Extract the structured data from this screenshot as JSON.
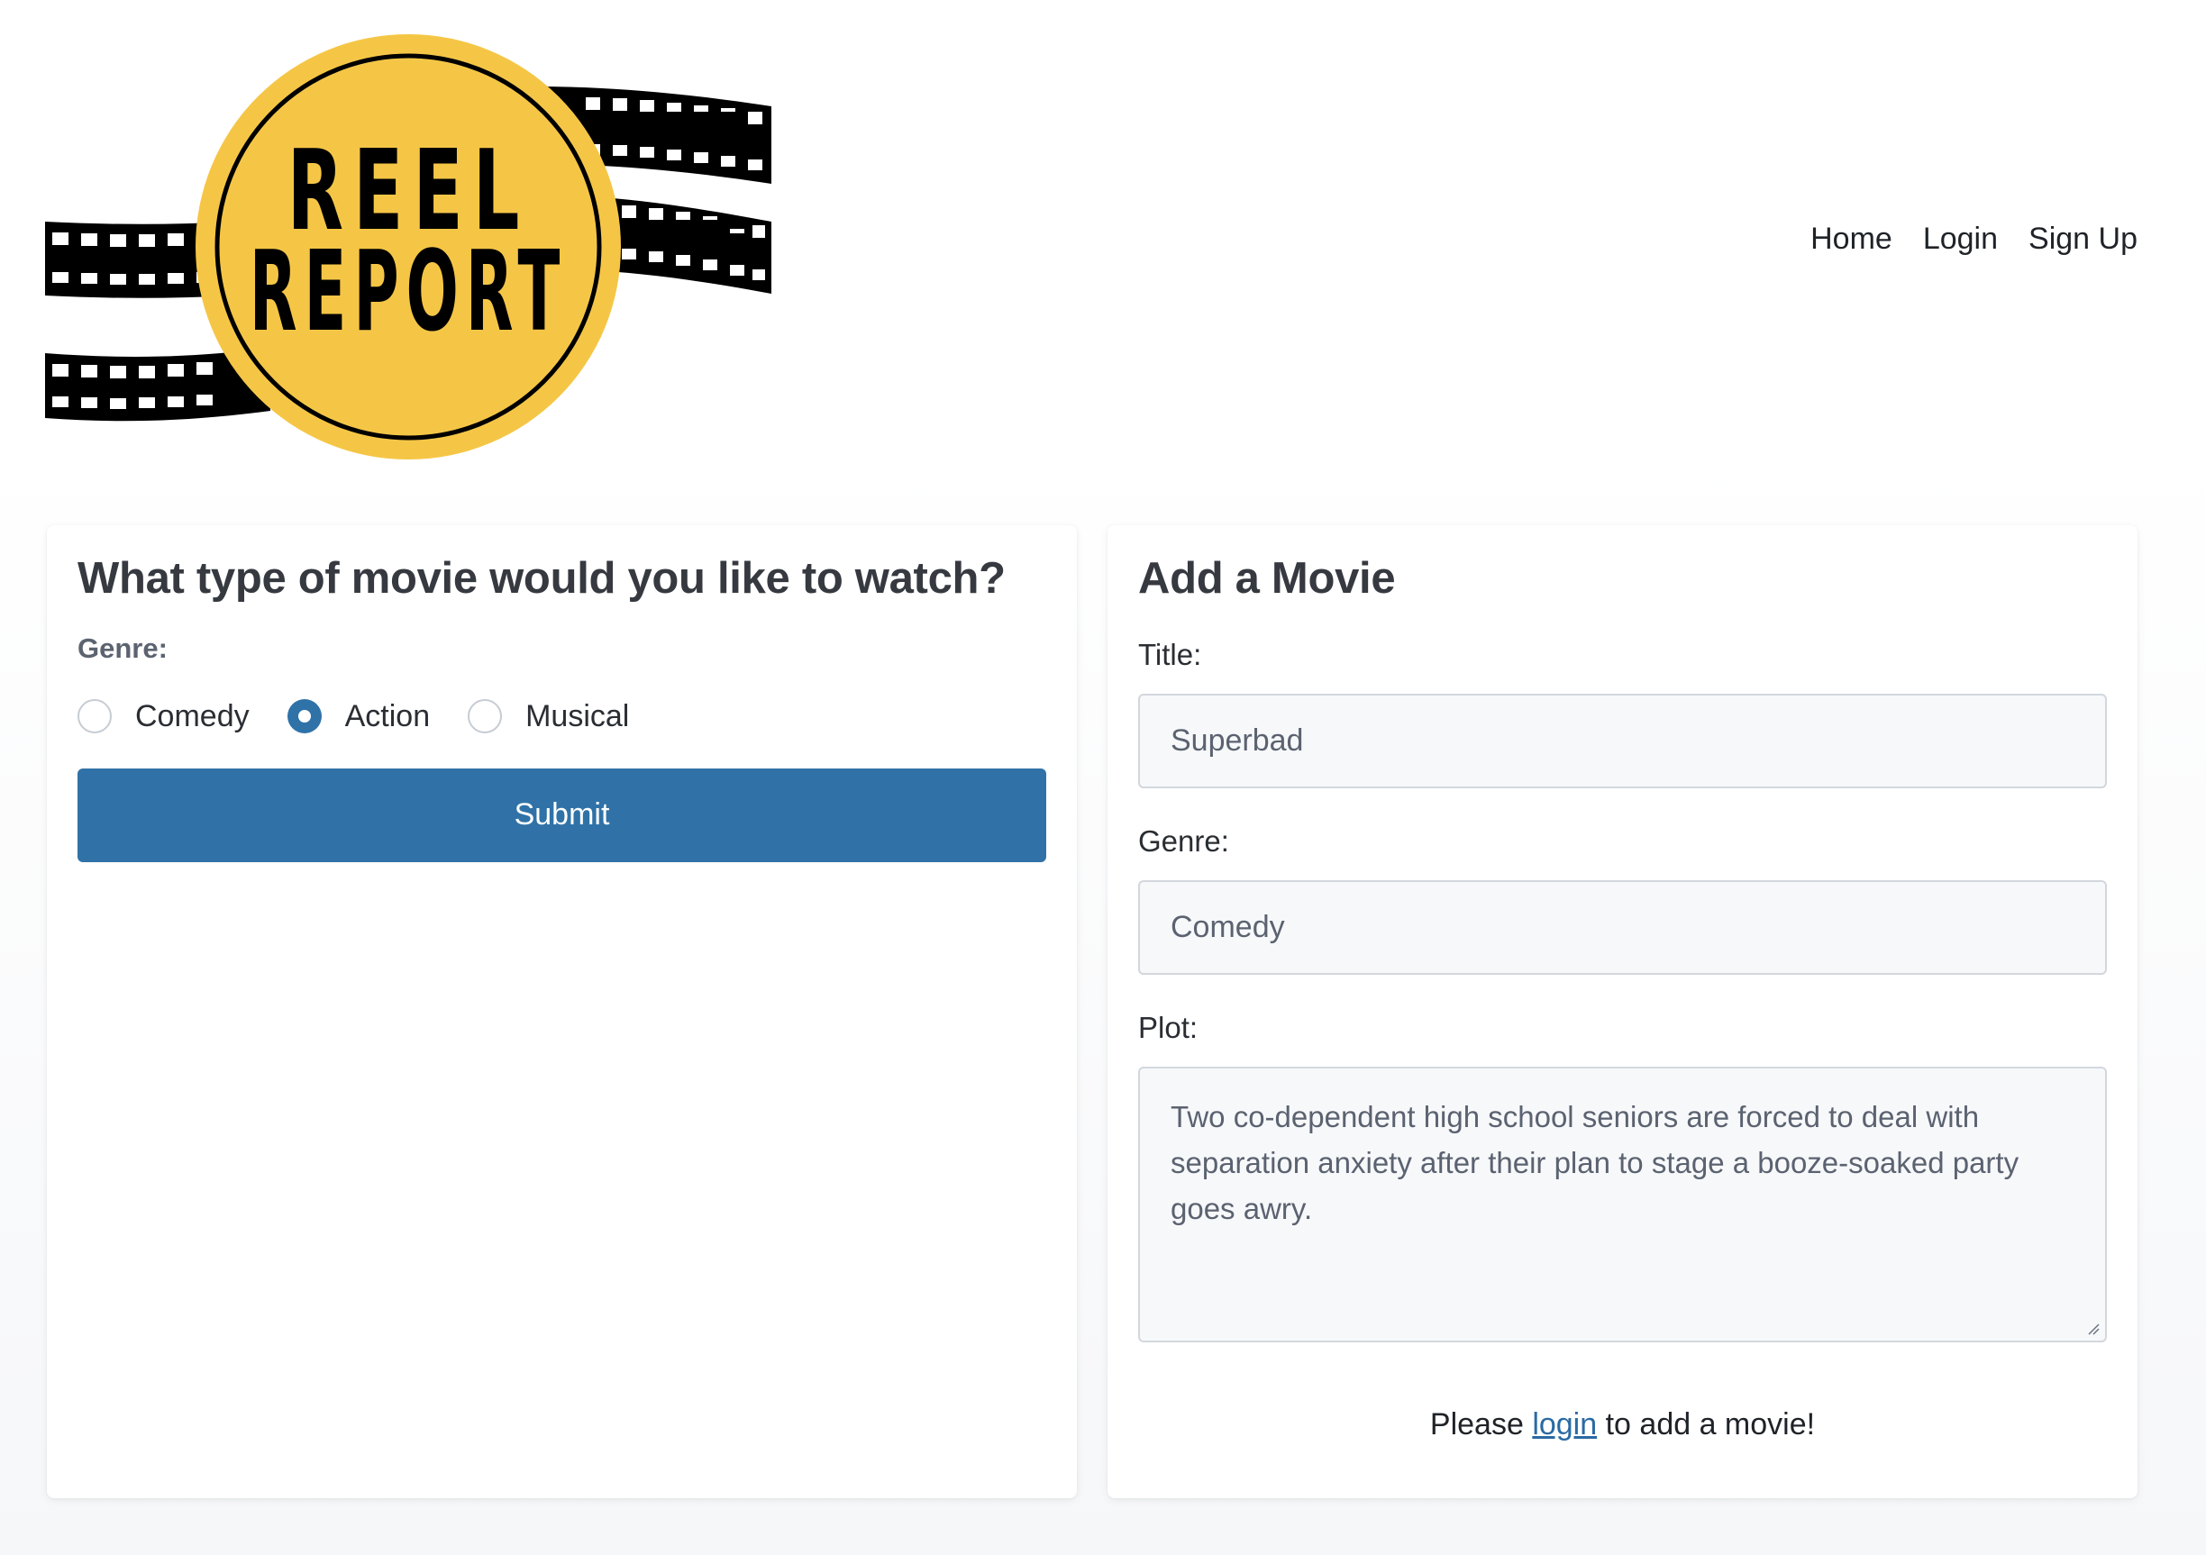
{
  "logo": {
    "line1": "REEL",
    "line2": "REPORT",
    "badge_color": "#F5C646",
    "film_color": "#000000"
  },
  "nav": {
    "items": [
      {
        "label": "Home"
      },
      {
        "label": "Login"
      },
      {
        "label": "Sign Up"
      }
    ]
  },
  "search_card": {
    "title": "What type of movie would you like to watch?",
    "genre_label": "Genre:",
    "options": [
      {
        "label": "Comedy",
        "checked": false
      },
      {
        "label": "Action",
        "checked": true
      },
      {
        "label": "Musical",
        "checked": false
      }
    ],
    "submit_label": "Submit"
  },
  "add_card": {
    "title": "Add a Movie",
    "title_label": "Title:",
    "title_value": "Superbad",
    "genre_label": "Genre:",
    "genre_value": "Comedy",
    "plot_label": "Plot:",
    "plot_value": "Two co-dependent high school seniors are forced to deal with separation anxiety after their plan to stage a booze-soaked party goes awry.",
    "note_before": "Please ",
    "note_link": "login",
    "note_after": " to add a movie!"
  },
  "colors": {
    "accent": "#3072A7",
    "link": "#2A6AA3",
    "heading": "#363A40"
  }
}
